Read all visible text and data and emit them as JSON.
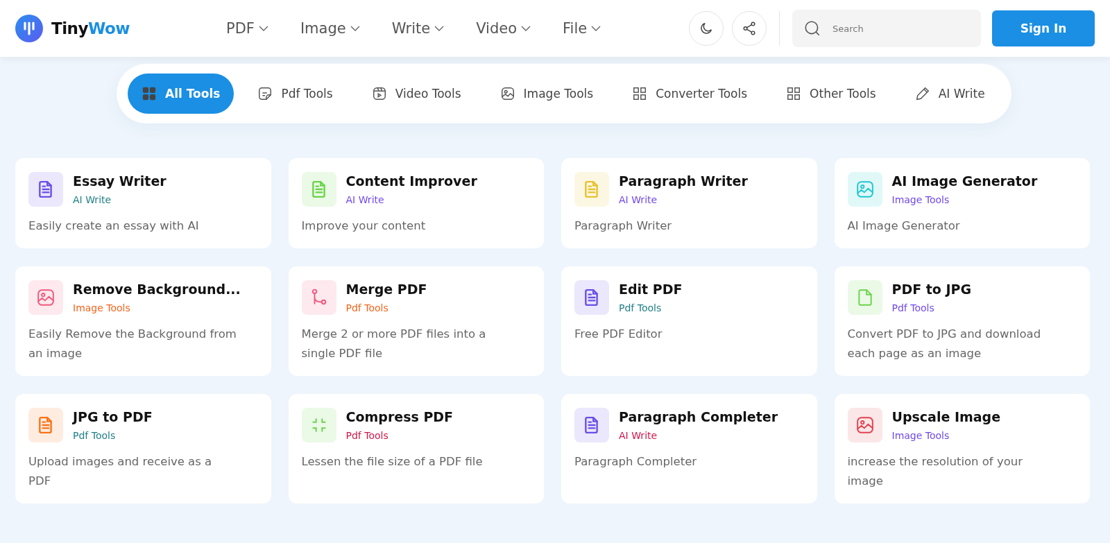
{
  "header": {
    "logo": {
      "part1": "Tiny",
      "part2": "Wow"
    },
    "nav": [
      {
        "label": "PDF"
      },
      {
        "label": "Image"
      },
      {
        "label": "Write"
      },
      {
        "label": "Video"
      },
      {
        "label": "File"
      }
    ],
    "search": {
      "placeholder": "Search"
    },
    "sign_in": "Sign In"
  },
  "tabs": [
    {
      "label": "All Tools",
      "kind": "all",
      "selected": true
    },
    {
      "label": "Pdf Tools",
      "kind": "pdf",
      "selected": false
    },
    {
      "label": "Video Tools",
      "kind": "video",
      "selected": false
    },
    {
      "label": "Image Tools",
      "kind": "image",
      "selected": false
    },
    {
      "label": "Converter Tools",
      "kind": "converter",
      "selected": false
    },
    {
      "label": "Other Tools",
      "kind": "other",
      "selected": false
    },
    {
      "label": "AI Write",
      "kind": "write",
      "selected": false
    }
  ],
  "cards": [
    {
      "title": "Essay Writer",
      "category": {
        "label": "AI Write",
        "color": "#1f7f86"
      },
      "description": "Easily create an essay with AI",
      "icon": {
        "kind": "doc",
        "color": "#6b4ee6"
      }
    },
    {
      "title": "Content Improver",
      "category": {
        "label": "AI Write",
        "color": "#7048e8"
      },
      "description": "Improve your content",
      "icon": {
        "kind": "doc",
        "color": "#6ad44a"
      }
    },
    {
      "title": "Paragraph Writer",
      "category": {
        "label": "AI Write",
        "color": "#7048e8"
      },
      "description": "Paragraph Writer",
      "icon": {
        "kind": "doc",
        "color": "#e6c22c"
      }
    },
    {
      "title": "AI Image Generator",
      "category": {
        "label": "Image Tools",
        "color": "#7048e8"
      },
      "description": "AI Image Generator",
      "icon": {
        "kind": "image",
        "color": "#1ec8d0"
      }
    },
    {
      "title": "Remove Background...",
      "category": {
        "label": "Image Tools",
        "color": "#f2651c"
      },
      "description": "Easily Remove the Background from an image",
      "icon": {
        "kind": "image",
        "color": "#f05a7e"
      }
    },
    {
      "title": "Merge PDF",
      "category": {
        "label": "Pdf Tools",
        "color": "#f2651c"
      },
      "description": "Merge 2 or more PDF files into a single PDF file",
      "icon": {
        "kind": "merge",
        "color": "#f05a7e"
      }
    },
    {
      "title": "Edit PDF",
      "category": {
        "label": "Pdf Tools",
        "color": "#1f7f86"
      },
      "description": "Free PDF Editor",
      "icon": {
        "kind": "doc",
        "color": "#6b4ee6"
      }
    },
    {
      "title": "PDF to JPG",
      "category": {
        "label": "Pdf Tools",
        "color": "#7048e8"
      },
      "description": "Convert PDF to JPG and download each page as an image",
      "icon": {
        "kind": "file",
        "color": "#6ad44a"
      }
    },
    {
      "title": "JPG to PDF",
      "category": {
        "label": "Pdf Tools",
        "color": "#1f7f86"
      },
      "description": "Upload images and receive as a PDF",
      "icon": {
        "kind": "doc",
        "color": "#f97316"
      }
    },
    {
      "title": "Compress PDF",
      "category": {
        "label": "Pdf Tools",
        "color": "#d1164a"
      },
      "description": "Lessen the file size of a PDF file",
      "icon": {
        "kind": "compress",
        "color": "#6ad44a"
      }
    },
    {
      "title": "Paragraph Completer",
      "category": {
        "label": "AI Write",
        "color": "#d1164a"
      },
      "description": "Paragraph Completer",
      "icon": {
        "kind": "doc",
        "color": "#6b4ee6"
      }
    },
    {
      "title": "Upscale Image",
      "category": {
        "label": "Image Tools",
        "color": "#7048e8"
      },
      "description": "increase the resolution of your image",
      "icon": {
        "kind": "image",
        "color": "#e0434f"
      }
    }
  ]
}
